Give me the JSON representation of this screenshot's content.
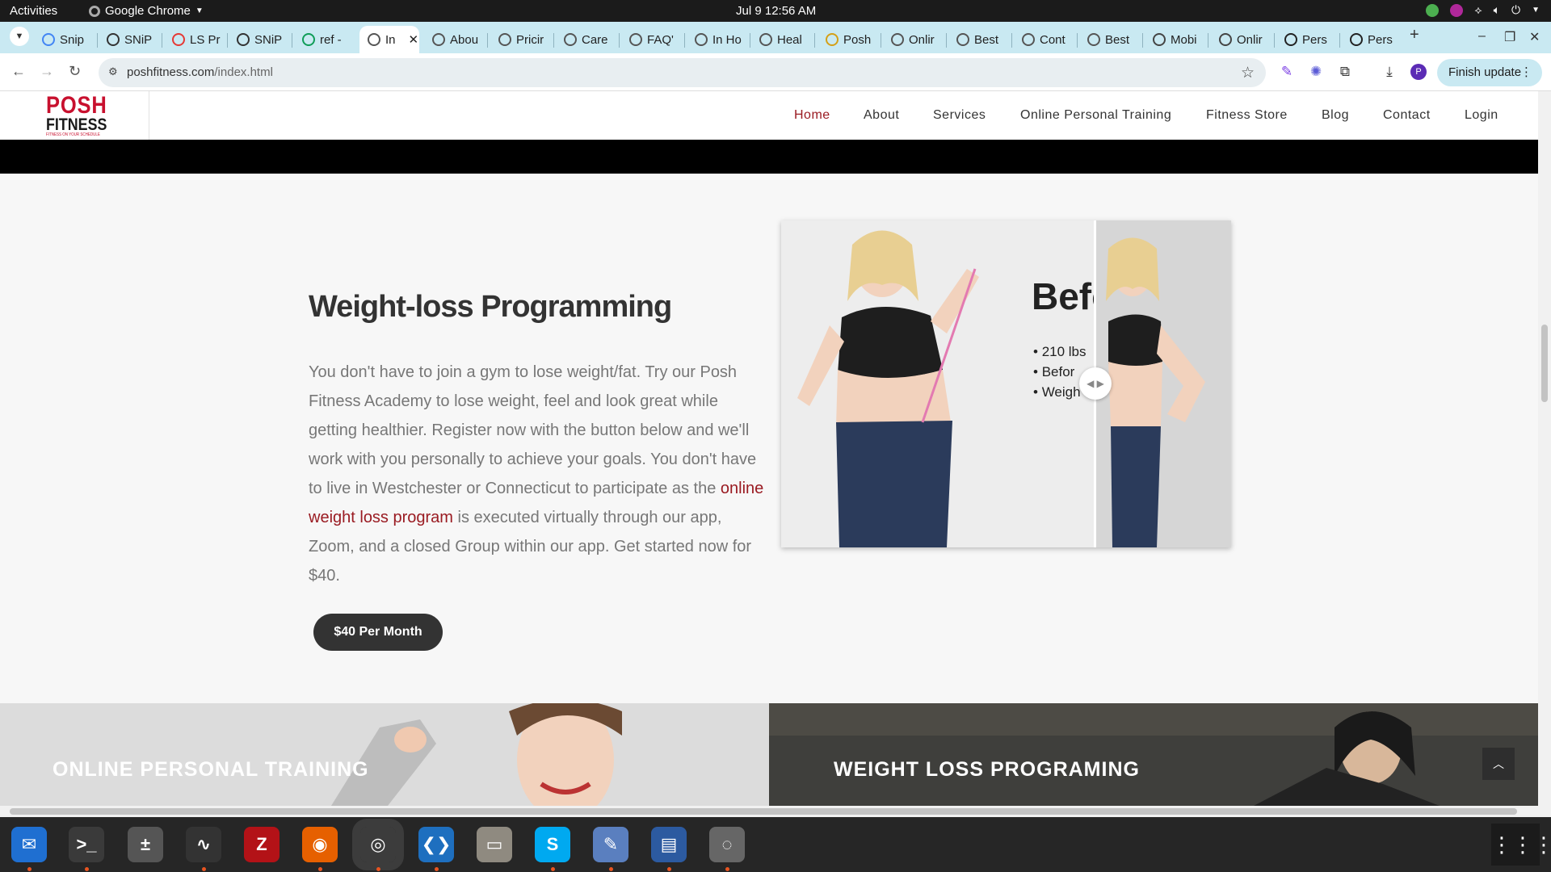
{
  "system": {
    "activities": "Activities",
    "app_name": "Google Chrome",
    "clock": "Jul 9  12:56 AM"
  },
  "tabs": [
    {
      "label": "Snip",
      "icon": "docs-icon"
    },
    {
      "label": "SNiP",
      "icon": "snip-icon"
    },
    {
      "label": "LS Pr",
      "icon": "ls-icon"
    },
    {
      "label": "SNiP",
      "icon": "snip-icon"
    },
    {
      "label": "ref - ",
      "icon": "sheets-icon"
    },
    {
      "label": "In",
      "icon": "globe-icon",
      "active": true
    },
    {
      "label": "Abou",
      "icon": "globe-icon"
    },
    {
      "label": "Pricir",
      "icon": "globe-icon"
    },
    {
      "label": "Care",
      "icon": "globe-icon"
    },
    {
      "label": "FAQ'",
      "icon": "globe-icon"
    },
    {
      "label": "In Ho",
      "icon": "globe-icon"
    },
    {
      "label": "Heal",
      "icon": "globe-icon"
    },
    {
      "label": "Posh",
      "icon": "posh-icon"
    },
    {
      "label": "Onlir",
      "icon": "globe-icon"
    },
    {
      "label": "Best",
      "icon": "globe-icon"
    },
    {
      "label": "Cont",
      "icon": "globe-icon"
    },
    {
      "label": "Best",
      "icon": "globe-icon"
    },
    {
      "label": "Mobi",
      "icon": "app-icon"
    },
    {
      "label": "Onlir",
      "icon": "app-icon"
    },
    {
      "label": "Pers",
      "icon": "fs-icon"
    },
    {
      "label": "Pers",
      "icon": "fs-icon"
    }
  ],
  "toolbar": {
    "url_host": "poshfitness.com",
    "url_path": "/index.html",
    "finish_update": "Finish update",
    "profile_initial": "P"
  },
  "site": {
    "logo_line1": "POSH",
    "logo_line2": "FITNESS",
    "logo_tagline": "FITNESS ON YOUR SCHEDULE",
    "nav": [
      "Home",
      "About",
      "Services",
      "Online Personal Training",
      "Fitness Store",
      "Blog",
      "Contact",
      "Login"
    ],
    "nav_active": "Home"
  },
  "weight_loss": {
    "title": "Weight-loss Programming",
    "body_part1": "You don't have to join a gym to lose weight/fat. Try our Posh Fitness Academy to lose weight, feel and look great while getting healthier. Register now with the button below and we'll work with you personally to achieve your goals. You don't have to live in Westchester or Connecticut to participate as the ",
    "body_link": "online weight loss program",
    "body_part2": " is executed virtually through our app, Zoom, and a closed Group within our app. Get started now for $40.",
    "button": "$40 Per Month"
  },
  "before_after": {
    "heading": "Befo",
    "bullets": [
      "210 lbs",
      "Befor",
      "Weigh"
    ]
  },
  "panels": {
    "left_title": "ONLINE PERSONAL TRAINING",
    "right_title": "WEIGHT LOSS PROGRAMING"
  },
  "colors": {
    "brand_red": "#c8102e",
    "nav_active": "#9a1b22",
    "tabstrip": "#c9e9f2"
  },
  "dock_apps": [
    "thunderbird-icon",
    "terminal-icon",
    "calculator-icon",
    "system-monitor-icon",
    "filezilla-icon",
    "firefox-icon",
    "chrome-icon",
    "vscode-icon",
    "files-icon",
    "skype-icon",
    "text-editor-icon",
    "document-viewer-icon",
    "disk-icon"
  ]
}
